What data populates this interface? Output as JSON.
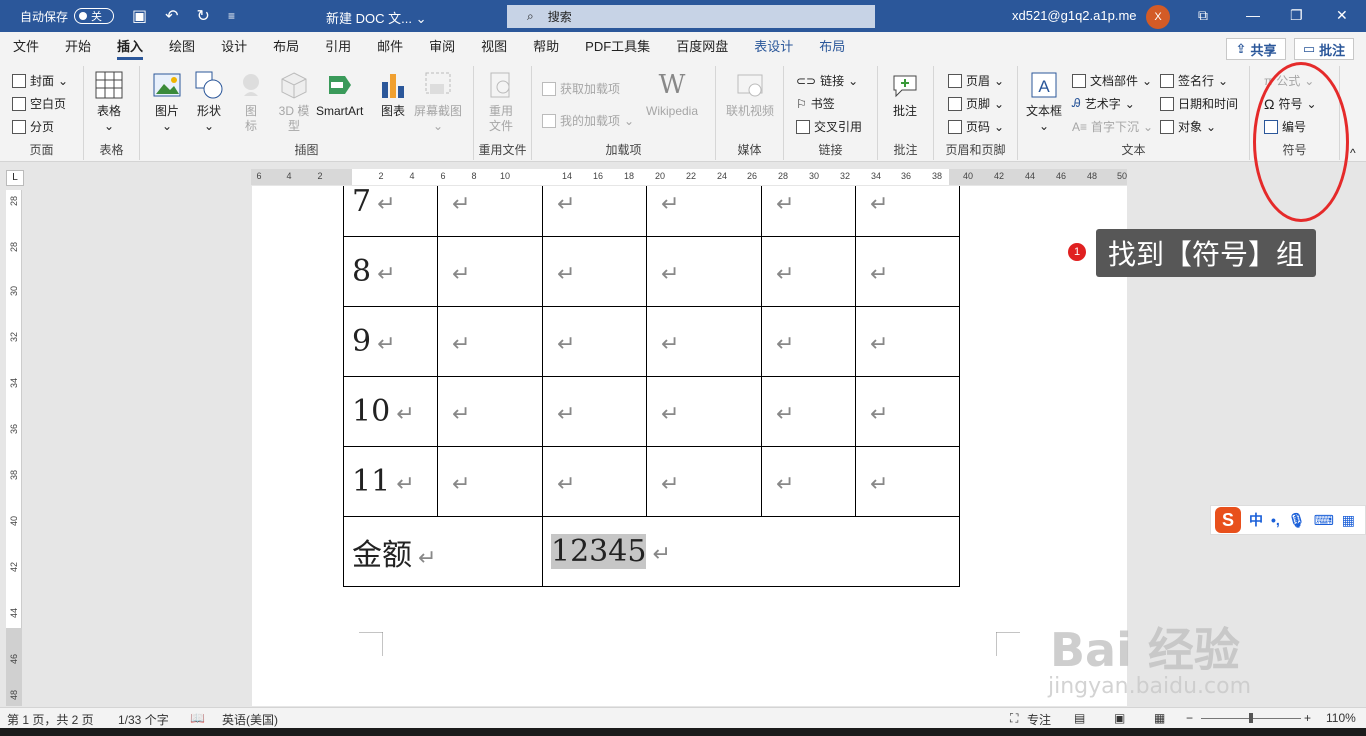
{
  "titlebar": {
    "autosave_label": "自动保存",
    "autosave_state": "关",
    "doc_title": "新建 DOC 文...",
    "search_placeholder": "搜索",
    "user": "xd521@g1q2.a1p.me",
    "avatar_letter": "X"
  },
  "tabs": [
    "文件",
    "开始",
    "插入",
    "绘图",
    "设计",
    "布局",
    "引用",
    "邮件",
    "审阅",
    "视图",
    "帮助",
    "PDF工具集",
    "百度网盘",
    "表设计",
    "布局"
  ],
  "active_tab": "插入",
  "share_label": "共享",
  "comment_label": "批注",
  "ribbon": {
    "pages": {
      "label": "页面",
      "cover": "封面",
      "blank": "空白页",
      "break": "分页"
    },
    "table": {
      "label": "表格",
      "table": "表格"
    },
    "illustrations": {
      "label": "插图",
      "picture": "图片",
      "shapes": "形状",
      "icons": "图标",
      "model3d": "3D 模型",
      "smartart": "SmartArt",
      "chart": "图表",
      "screenshot": "屏幕截图"
    },
    "reuse": {
      "label": "重用文件",
      "reuse": "重用文件"
    },
    "addins": {
      "label": "加载项",
      "get": "获取加载项",
      "my": "我的加载项",
      "wiki": "Wikipedia"
    },
    "media": {
      "label": "媒体",
      "video": "联机视频"
    },
    "links": {
      "label": "链接",
      "link": "链接",
      "bookmark": "书签",
      "crossref": "交叉引用"
    },
    "comments": {
      "label": "批注",
      "comment": "批注"
    },
    "header_footer": {
      "label": "页眉和页脚",
      "header": "页眉",
      "footer": "页脚",
      "page_number": "页码"
    },
    "text": {
      "label": "文本",
      "textbox": "文本框",
      "quickparts": "文档部件",
      "wordart": "艺术字",
      "dropcap": "首字下沉",
      "signature": "签名行",
      "datetime": "日期和时间",
      "object": "对象"
    },
    "symbols": {
      "label": "符号",
      "equation": "公式",
      "symbol": "符号",
      "number": "编号"
    }
  },
  "ruler": {
    "h_ticks": [
      "6",
      "4",
      "2",
      "2",
      "4",
      "6",
      "8",
      "10",
      "14",
      "16",
      "18",
      "20",
      "22",
      "24",
      "26",
      "28",
      "30",
      "32",
      "34",
      "36",
      "38",
      "40",
      "42",
      "44",
      "46",
      "48",
      "50"
    ],
    "v_ticks": [
      "28",
      "28",
      "30",
      "32",
      "34",
      "36",
      "38",
      "40",
      "42",
      "44",
      "46",
      "48"
    ]
  },
  "document": {
    "rows": [
      {
        "num": "7"
      },
      {
        "num": "8"
      },
      {
        "num": "9"
      },
      {
        "num": "10"
      },
      {
        "num": "11"
      }
    ],
    "total_label": "金额",
    "total_value": "12345"
  },
  "annotation": {
    "number": "1",
    "text": "找到【符号】组"
  },
  "ime": {
    "lang": "中"
  },
  "watermark": {
    "brand": "Bai 经验",
    "url": "jingyan.baidu.com"
  },
  "status": {
    "page": "第 1 页，共 2 页",
    "words": "1/33 个字",
    "lang": "英语(美国)",
    "focus": "专注",
    "zoom": "110%",
    "zoom_fraction": 0.5
  },
  "colors": {
    "brand": "#2b579a",
    "annotation_circle": "#e52a2a"
  }
}
